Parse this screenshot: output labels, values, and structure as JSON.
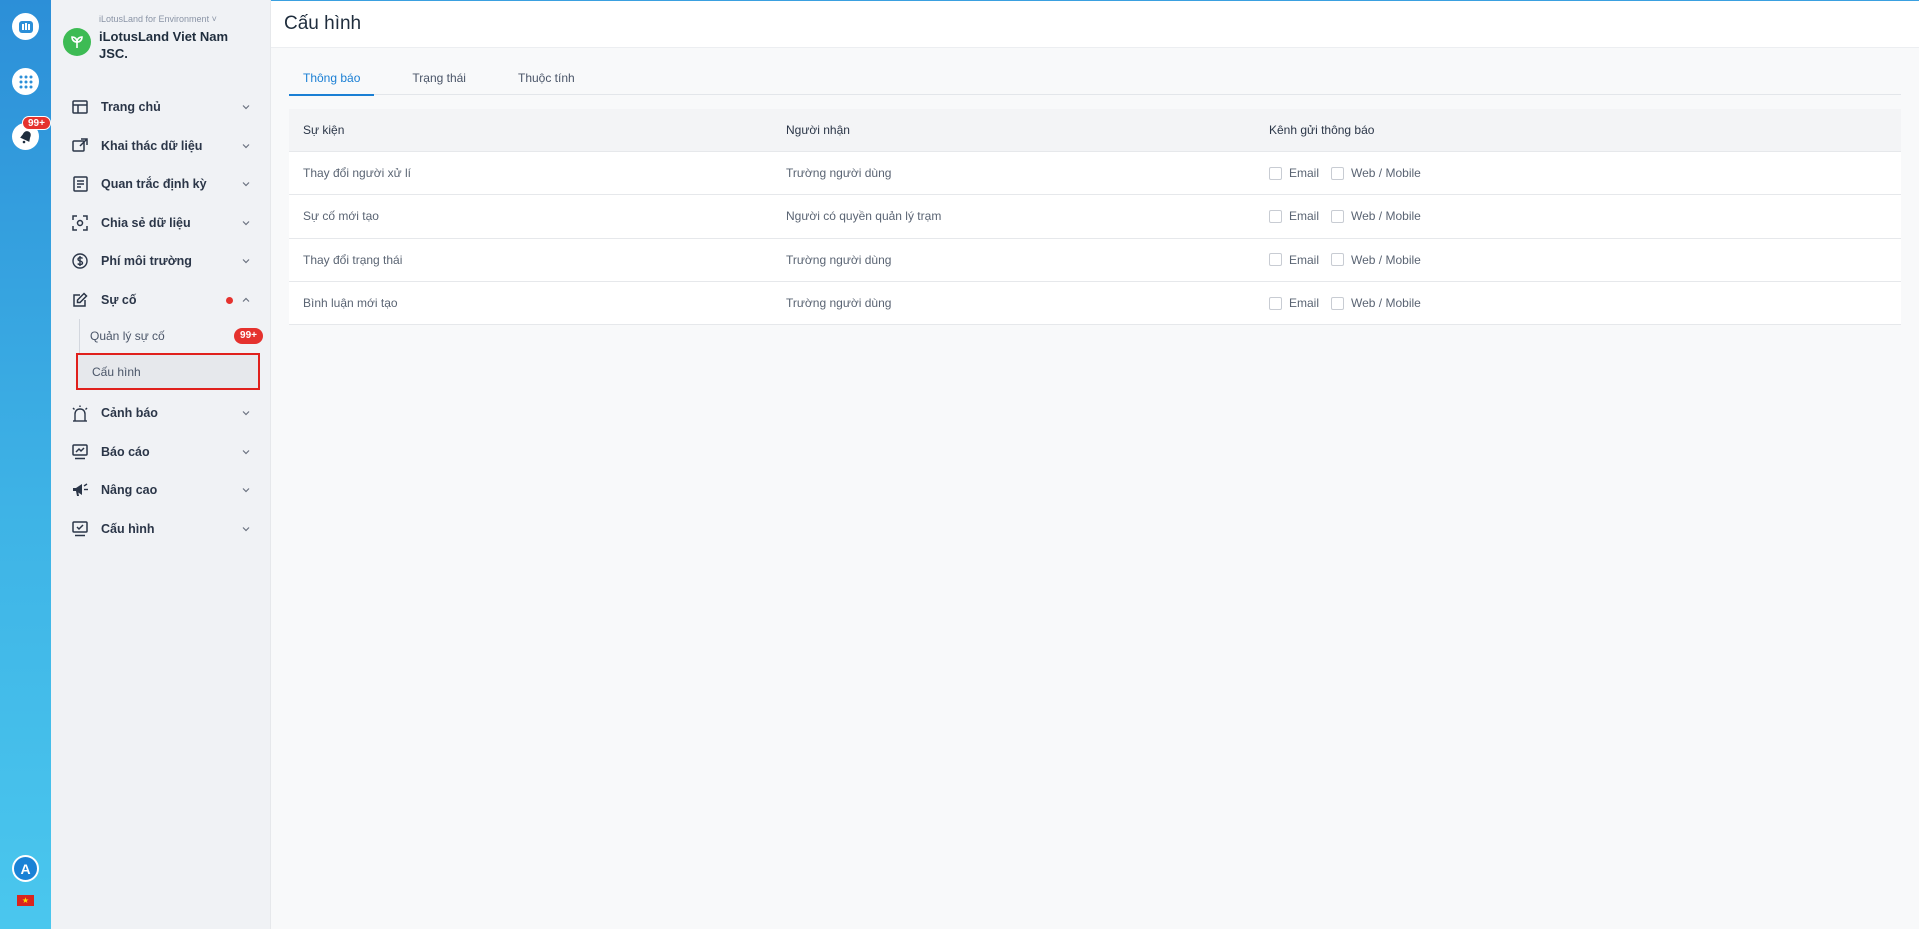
{
  "rail": {
    "notification_badge": "99+",
    "avatar_letter": "A",
    "flag_star": "★"
  },
  "sidebar": {
    "org_subtitle": "iLotusLand for Environment ˅",
    "org_name": "iLotusLand Viet Nam JSC.",
    "menu": [
      {
        "label": "Trang chủ",
        "icon": "home-icon"
      },
      {
        "label": "Khai thác dữ liệu",
        "icon": "data-mining-icon"
      },
      {
        "label": "Quan trắc định kỳ",
        "icon": "periodic-monitoring-icon"
      },
      {
        "label": "Chia sẻ dữ liệu",
        "icon": "share-data-icon"
      },
      {
        "label": "Phí môi trường",
        "icon": "fee-icon"
      },
      {
        "label": "Sự cố",
        "icon": "incident-icon"
      }
    ],
    "incident_sub": [
      {
        "label": "Quản lý sự cố",
        "badge": "99+"
      },
      {
        "label": "Cấu hình"
      }
    ],
    "menu_bottom": [
      {
        "label": "Cảnh báo",
        "icon": "alarm-icon"
      },
      {
        "label": "Báo cáo",
        "icon": "report-icon"
      },
      {
        "label": "Nâng cao",
        "icon": "megaphone-icon"
      },
      {
        "label": "Cấu hình",
        "icon": "config-icon"
      }
    ]
  },
  "page": {
    "title": "Cấu hình",
    "tabs": [
      "Thông báo",
      "Trạng thái",
      "Thuộc tính"
    ],
    "active_tab": "Thông báo"
  },
  "table": {
    "headers": [
      "Sự kiện",
      "Người nhận",
      "Kênh gửi thông báo"
    ],
    "channel_labels": [
      "Email",
      "Web / Mobile"
    ],
    "rows": [
      {
        "event": "Thay đổi người xử lí",
        "receiver": "Trường người dùng"
      },
      {
        "event": "Sự cố mới tạo",
        "receiver": "Người có quyền quản lý trạm"
      },
      {
        "event": "Thay đổi trạng thái",
        "receiver": "Trường người dùng"
      },
      {
        "event": "Bình luận mới tạo",
        "receiver": "Trường người dùng"
      }
    ]
  },
  "colors": {
    "accent": "#1a7fd4",
    "badge": "#e5322e",
    "highlight_border": "#e0201c"
  }
}
